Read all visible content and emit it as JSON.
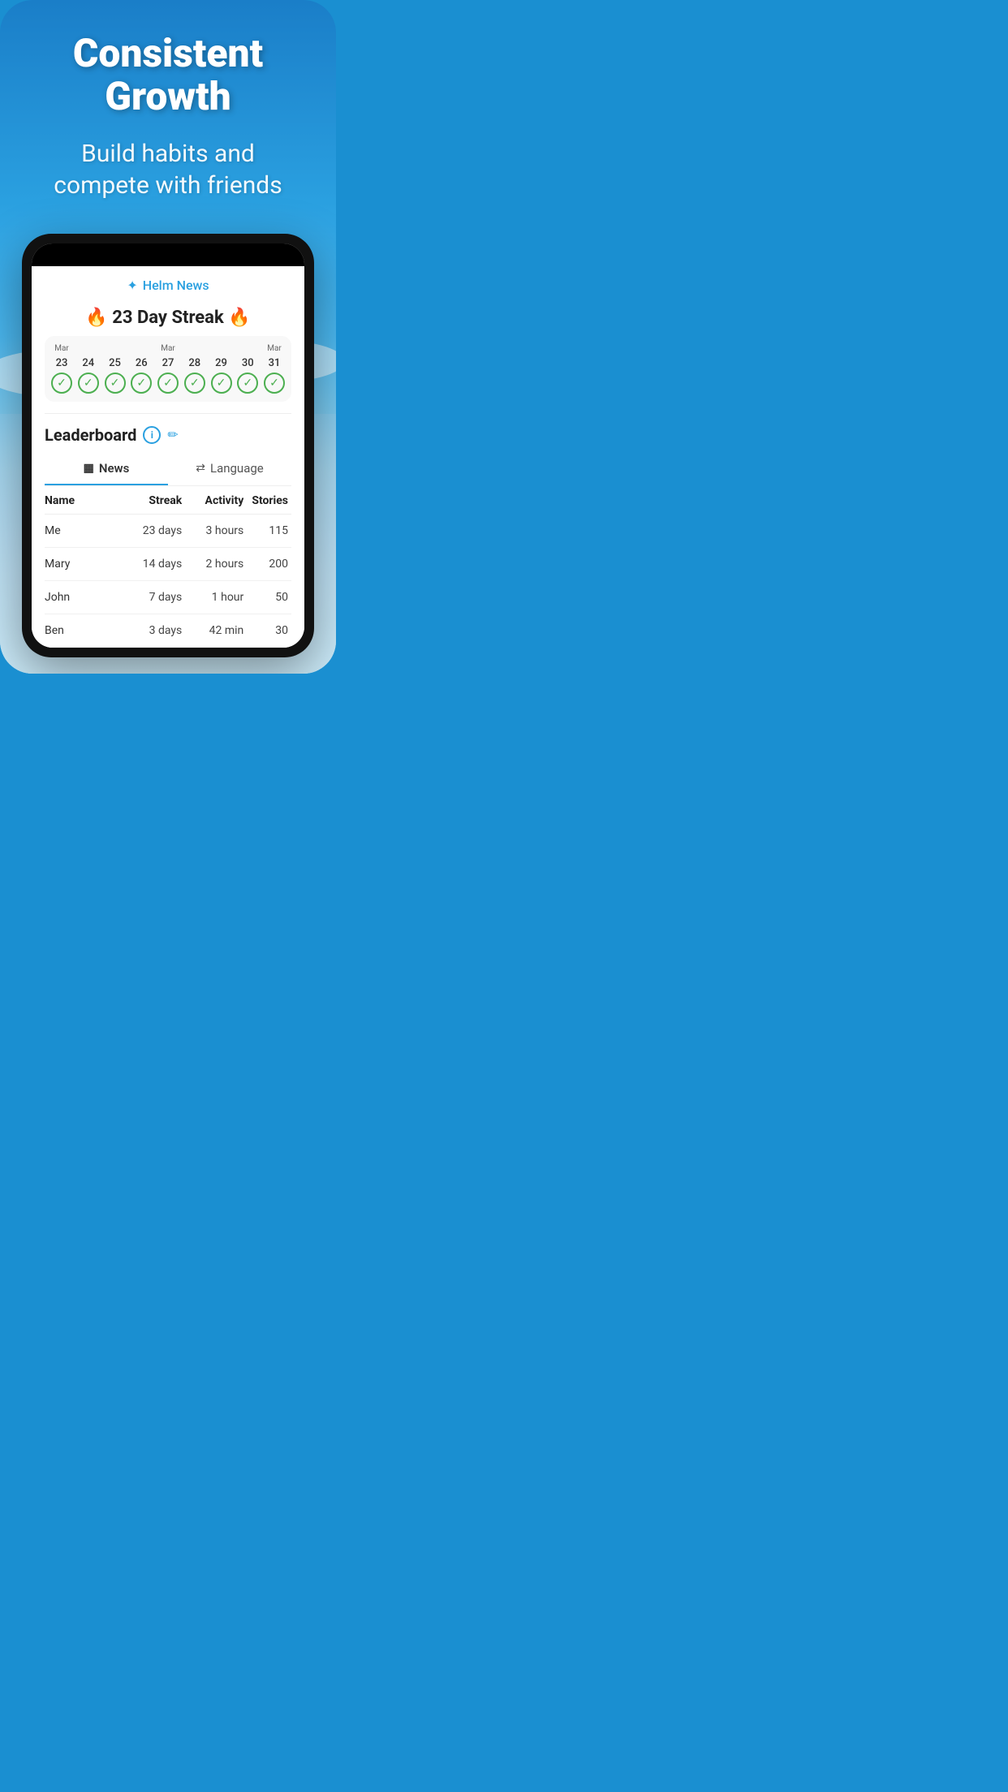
{
  "hero": {
    "main_title": "Consistent Growth",
    "subtitle": "Build habits and\ncompete with friends"
  },
  "app": {
    "name": "Helm News",
    "helm_icon": "✦"
  },
  "streak": {
    "label": "🔥 23 Day Streak 🔥",
    "days": [
      {
        "month": "Mar",
        "day": "23",
        "checked": true
      },
      {
        "month": "",
        "day": "24",
        "checked": true
      },
      {
        "month": "",
        "day": "25",
        "checked": true
      },
      {
        "month": "",
        "day": "26",
        "checked": true
      },
      {
        "month": "Mar",
        "day": "27",
        "checked": true
      },
      {
        "month": "",
        "day": "28",
        "checked": true
      },
      {
        "month": "",
        "day": "29",
        "checked": true
      },
      {
        "month": "",
        "day": "30",
        "checked": true
      },
      {
        "month": "Mar",
        "day": "31",
        "checked": true
      }
    ]
  },
  "leaderboard": {
    "title": "Leaderboard",
    "tabs": [
      {
        "icon": "▦",
        "label": "News",
        "active": true
      },
      {
        "icon": "⇄",
        "label": "Language",
        "active": false
      }
    ],
    "columns": {
      "name": "Name",
      "streak": "Streak",
      "activity": "Activity",
      "stories": "Stories"
    },
    "rows": [
      {
        "name": "Me",
        "streak": "23 days",
        "activity": "3 hours",
        "stories": "115"
      },
      {
        "name": "Mary",
        "streak": "14 days",
        "activity": "2 hours",
        "stories": "200"
      },
      {
        "name": "John",
        "streak": "7 days",
        "activity": "1 hour",
        "stories": "50"
      },
      {
        "name": "Ben",
        "streak": "3 days",
        "activity": "42 min",
        "stories": "30"
      }
    ]
  },
  "colors": {
    "blue": "#2aa0e0",
    "green": "#4caf50",
    "dark": "#222222",
    "text": "#333333",
    "bg_light": "#f5f5f5"
  }
}
